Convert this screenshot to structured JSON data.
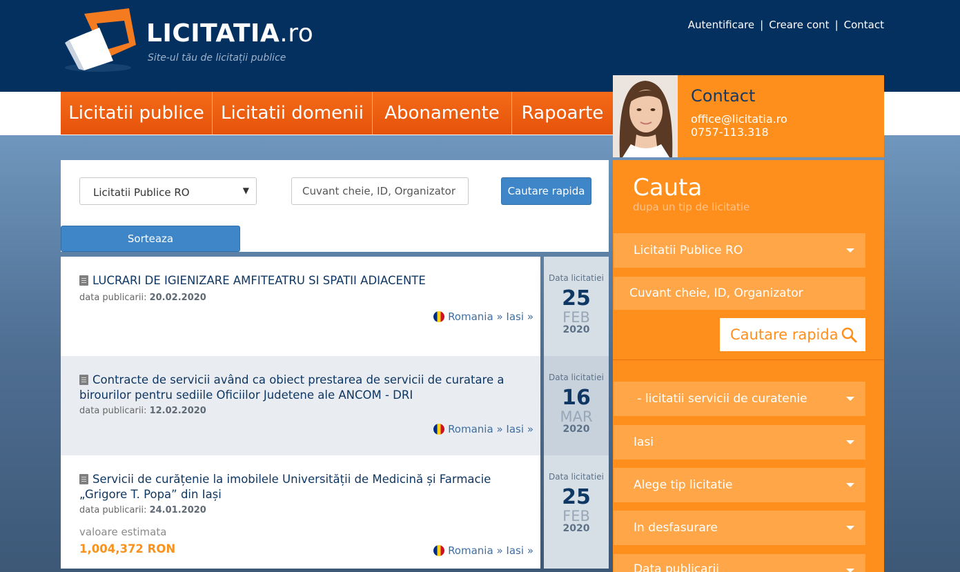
{
  "header": {
    "logo_text": "LICITATIA",
    "logo_tld": ".ro",
    "tagline": "Site-ul tău de licitații publice",
    "links": [
      "Autentificare",
      "Creare cont",
      "Contact"
    ],
    "separator": "|"
  },
  "nav": {
    "items": [
      "Licitatii publice",
      "Licitatii domenii",
      "Abonamente",
      "Rapoarte"
    ]
  },
  "contact": {
    "title": "Contact",
    "email": "office@licitatia.ro",
    "phone": "0757-113.318"
  },
  "search": {
    "select_value": "Licitatii Publice RO",
    "keyword_placeholder": "Cuvant cheie, ID, Organizator",
    "quick_button": "Cautare rapida",
    "sort_button": "Sorteaza"
  },
  "listings": [
    {
      "title": "LUCRARI DE IGIENIZARE AMFITEATRU SI SPATII ADIACENTE",
      "pub_label": "data publicarii:",
      "pub_date": "20.02.2020",
      "country": "Romania",
      "city": "Iasi",
      "date_label": "Data licitatiei",
      "day": "25",
      "month": "FEB",
      "year": "2020"
    },
    {
      "title": "Contracte de servicii având ca obiect prestarea de servicii de curatare a birourilor pentru sediile Oficiilor Judetene ale ANCOM - DRI",
      "pub_label": "data publicarii:",
      "pub_date": "12.02.2020",
      "country": "Romania",
      "city": "Iasi",
      "date_label": "Data licitatiei",
      "day": "16",
      "month": "MAR",
      "year": "2020"
    },
    {
      "title": "Servicii de curățenie la imobilele Universității de Medicină și Farmacie „Grigore T. Popa” din Iași",
      "pub_label": "data publicarii:",
      "pub_date": "24.01.2020",
      "est_label": "valoare estimata",
      "est_value": "1,004,372 RON",
      "country": "Romania",
      "city": "Iasi",
      "date_label": "Data licitatiei",
      "day": "25",
      "month": "FEB",
      "year": "2020"
    }
  ],
  "location_separator": "»",
  "right_panel": {
    "title": "Cauta",
    "subtitle": "dupa un tip de licitatie",
    "type_select": "Licitatii Publice RO",
    "keyword": "Cuvant cheie, ID, Organizator",
    "quick_button": "Cautare rapida",
    "filters": [
      " - licitatii servicii de curatenie",
      "Iasi",
      "Alege tip licitatie",
      "In desfasurare",
      "Data publicarii"
    ]
  },
  "colors": {
    "header_bg": "#03305f",
    "orange": "#ff8f1c",
    "nav_orange": "#f46b18",
    "blue_button": "#3e86c8",
    "title_blue": "#0f3763"
  },
  "icons": [
    "logo-mark-icon",
    "document-icon",
    "romania-flag-icon",
    "chevron-down-icon",
    "search-icon"
  ]
}
